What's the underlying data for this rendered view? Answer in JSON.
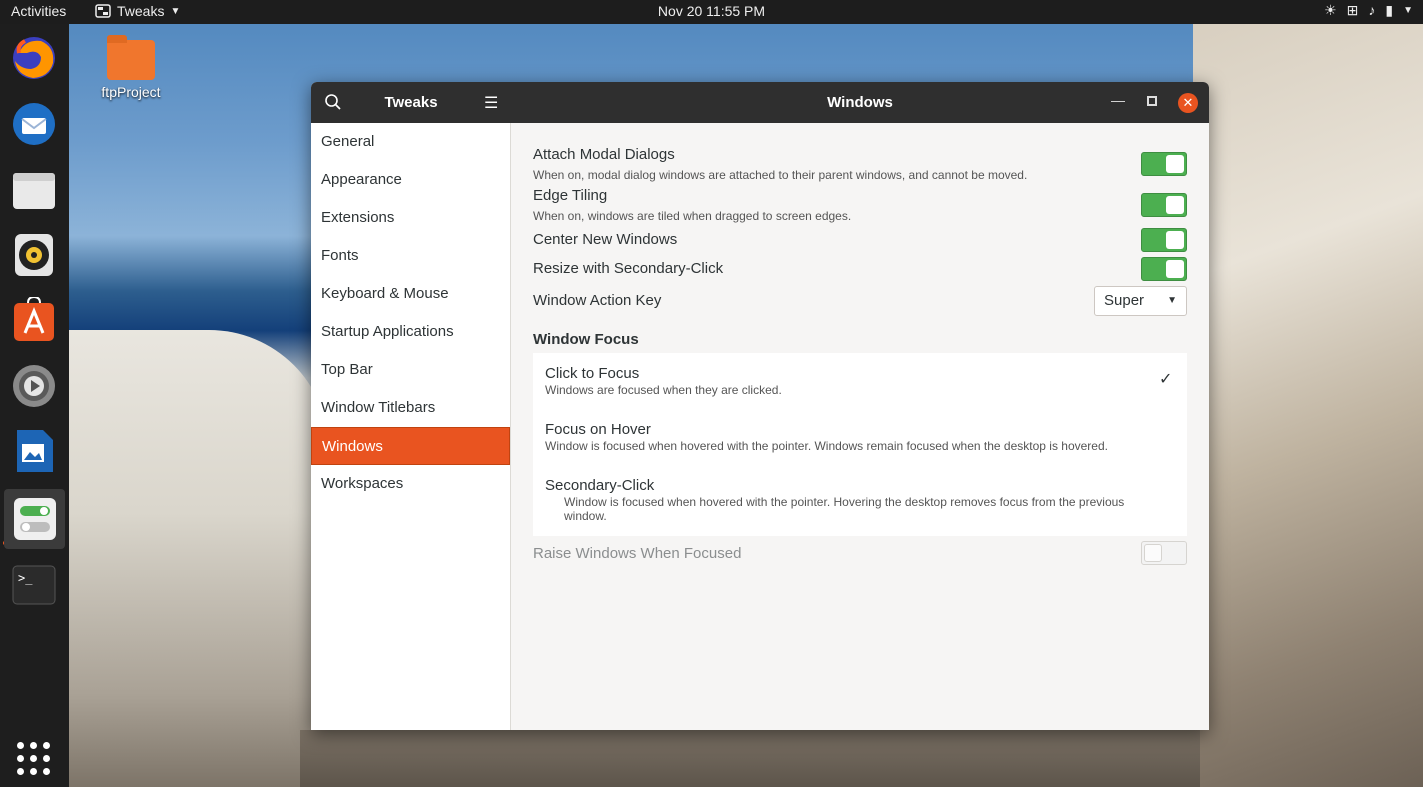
{
  "topbar": {
    "activities": "Activities",
    "app_name": "Tweaks",
    "clock": "Nov 20  11:55 PM"
  },
  "desktop": {
    "icon_label": "ftpProject"
  },
  "dock": {
    "items": [
      "firefox-icon",
      "thunderbird-icon",
      "files-icon",
      "rhythmbox-icon",
      "software-icon",
      "settings-icon",
      "libreoffice-writer-icon",
      "tweaks-icon",
      "terminal-icon"
    ],
    "show_apps": "apps-grid-icon"
  },
  "window": {
    "app_title": "Tweaks",
    "title": "Windows",
    "sidebar": [
      "General",
      "Appearance",
      "Extensions",
      "Fonts",
      "Keyboard & Mouse",
      "Startup Applications",
      "Top Bar",
      "Window Titlebars",
      "Windows",
      "Workspaces"
    ],
    "selected_index": 8,
    "settings": {
      "attach_modal": {
        "title": "Attach Modal Dialogs",
        "desc": "When on, modal dialog windows are attached to their parent windows, and cannot be moved.",
        "on": true
      },
      "edge_tiling": {
        "title": "Edge Tiling",
        "desc": "When on, windows are tiled when dragged to screen edges.",
        "on": true
      },
      "center_new": {
        "title": "Center New Windows",
        "on": true
      },
      "resize_secondary": {
        "title": "Resize with Secondary-Click",
        "on": true
      },
      "action_key": {
        "title": "Window Action Key",
        "value": "Super"
      }
    },
    "focus": {
      "section_title": "Window Focus",
      "options": [
        {
          "title": "Click to Focus",
          "desc": "Windows are focused when they are clicked.",
          "selected": true
        },
        {
          "title": "Focus on Hover",
          "desc": "Window is focused when hovered with the pointer. Windows remain focused when the desktop is hovered.",
          "selected": false
        },
        {
          "title": "Secondary-Click",
          "desc": "Window is focused when hovered with the pointer. Hovering the desktop removes focus from the previous window.",
          "selected": false
        }
      ]
    },
    "raise": {
      "title": "Raise Windows When Focused",
      "on": false
    }
  },
  "colors": {
    "accent": "#e95420",
    "toggle_on": "#4caf50"
  }
}
